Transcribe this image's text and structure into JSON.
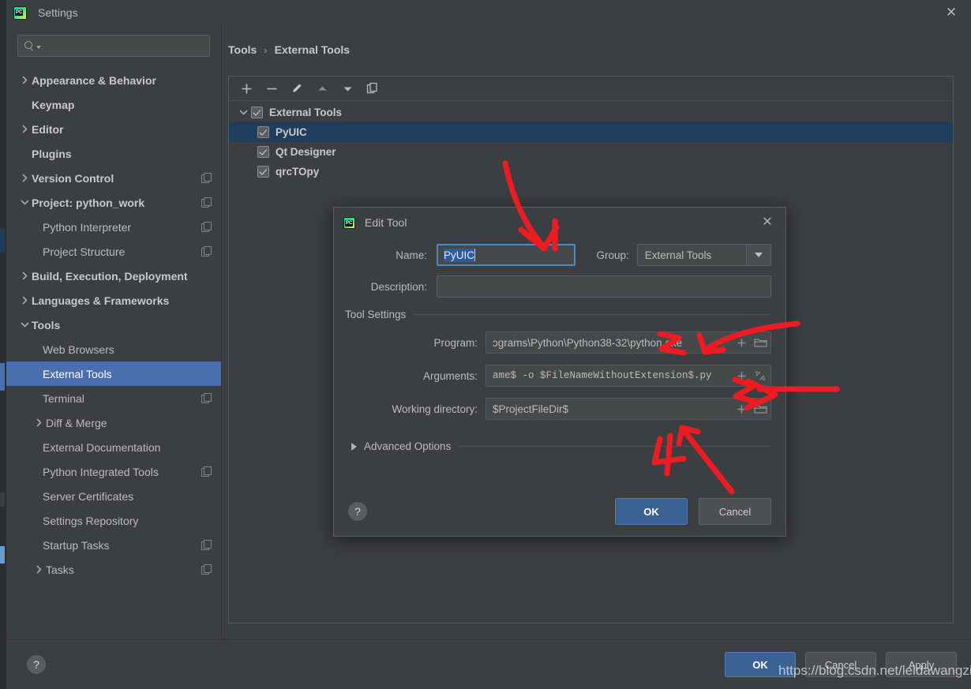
{
  "window": {
    "title": "Settings",
    "logo_text": "PC",
    "close_icon": "✕"
  },
  "search": {
    "value": "",
    "placeholder": ""
  },
  "sidebar": {
    "items": [
      {
        "label": "Appearance & Behavior",
        "twisty": "chevron-right",
        "level": 1,
        "bold": true,
        "badge": false
      },
      {
        "label": "Keymap",
        "twisty": "none",
        "level": 1,
        "bold": true,
        "badge": false
      },
      {
        "label": "Editor",
        "twisty": "chevron-right",
        "level": 1,
        "bold": true,
        "badge": false
      },
      {
        "label": "Plugins",
        "twisty": "none",
        "level": 1,
        "bold": true,
        "badge": false
      },
      {
        "label": "Version Control",
        "twisty": "chevron-right",
        "level": 1,
        "bold": true,
        "badge": true
      },
      {
        "label": "Project: python_work",
        "twisty": "chevron-down",
        "level": 1,
        "bold": true,
        "badge": true
      },
      {
        "label": "Python Interpreter",
        "twisty": "none",
        "level": 2,
        "bold": false,
        "badge": true
      },
      {
        "label": "Project Structure",
        "twisty": "none",
        "level": 2,
        "bold": false,
        "badge": true
      },
      {
        "label": "Build, Execution, Deployment",
        "twisty": "chevron-right",
        "level": 1,
        "bold": true,
        "badge": false
      },
      {
        "label": "Languages & Frameworks",
        "twisty": "chevron-right",
        "level": 1,
        "bold": true,
        "badge": false
      },
      {
        "label": "Tools",
        "twisty": "chevron-down",
        "level": 1,
        "bold": true,
        "badge": false
      },
      {
        "label": "Web Browsers",
        "twisty": "none",
        "level": 2,
        "bold": false,
        "badge": false
      },
      {
        "label": "External Tools",
        "twisty": "none",
        "level": 2,
        "bold": false,
        "badge": false,
        "selected": true
      },
      {
        "label": "Terminal",
        "twisty": "none",
        "level": 2,
        "bold": false,
        "badge": true
      },
      {
        "label": "Diff & Merge",
        "twisty": "chevron-right",
        "level": 2,
        "bold": false,
        "badge": false
      },
      {
        "label": "External Documentation",
        "twisty": "none",
        "level": 2,
        "bold": false,
        "badge": false
      },
      {
        "label": "Python Integrated Tools",
        "twisty": "none",
        "level": 2,
        "bold": false,
        "badge": true
      },
      {
        "label": "Server Certificates",
        "twisty": "none",
        "level": 2,
        "bold": false,
        "badge": false
      },
      {
        "label": "Settings Repository",
        "twisty": "none",
        "level": 2,
        "bold": false,
        "badge": false
      },
      {
        "label": "Startup Tasks",
        "twisty": "none",
        "level": 2,
        "bold": false,
        "badge": true
      },
      {
        "label": "Tasks",
        "twisty": "chevron-right",
        "level": 2,
        "bold": false,
        "badge": true
      }
    ]
  },
  "breadcrumb": {
    "parent": "Tools",
    "separator": "›",
    "current": "External Tools"
  },
  "tools_toolbar": {
    "add": "add-icon",
    "remove": "remove-icon",
    "edit": "pencil-icon",
    "move_up": "arrow-up-icon",
    "move_down": "arrow-down-icon",
    "copy": "copy-icon"
  },
  "tools_tree": {
    "root": {
      "label": "External Tools",
      "checked": true,
      "expanded": true
    },
    "children": [
      {
        "label": "PyUIC",
        "checked": true,
        "selected": true
      },
      {
        "label": "Qt Designer",
        "checked": true,
        "selected": false
      },
      {
        "label": "qrcTOpy",
        "checked": true,
        "selected": false
      }
    ]
  },
  "dialog": {
    "title": "Edit Tool",
    "close_icon": "✕",
    "name_label": "Name:",
    "name_value": "PyUIC",
    "group_label": "Group:",
    "group_value": "External Tools",
    "description_label": "Description:",
    "description_value": "",
    "tool_settings_label": "Tool Settings",
    "program_label": "Program:",
    "program_value": "ɔgrams\\Python\\Python38-32\\python.exe",
    "arguments_label": "Arguments:",
    "arguments_value": "ame$ -o $FileNameWithoutExtension$.py",
    "working_dir_label": "Working directory:",
    "working_dir_value": "$ProjectFileDir$",
    "advanced_options_label": "Advanced Options",
    "help_icon": "?",
    "ok_label": "OK",
    "cancel_label": "Cancel",
    "insert_macro_icon": "plus-icon",
    "browse_icon": "folder-icon",
    "expand_icon": "expand-icon"
  },
  "bottom_bar": {
    "help_icon": "?",
    "ok_label": "OK",
    "cancel_label": "Cancel",
    "apply_label": "Apply"
  },
  "annotations": {
    "marks": [
      "1",
      "2",
      "3",
      "4"
    ],
    "color": "#ee1c22"
  },
  "watermark": {
    "text": "https://blog.csdn.net/leidawangzi"
  },
  "colors": {
    "accent_blue": "#4b6eaf",
    "panel_bg": "#3c3f41",
    "field_bg": "#45494a",
    "selection_blue": "#2f5b9c",
    "row_selected_dark": "#1f3d5c",
    "marker_red": "#ee1c22"
  }
}
